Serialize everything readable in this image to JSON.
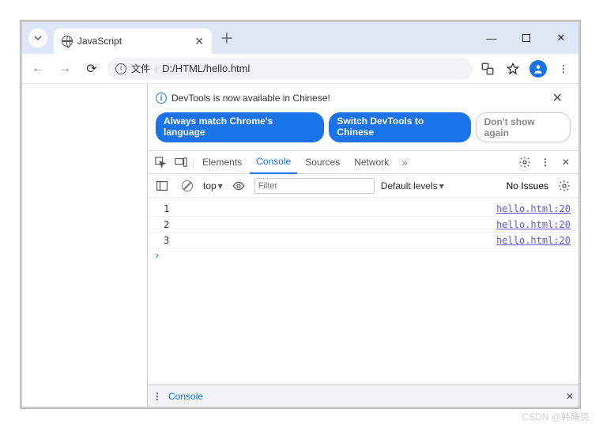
{
  "tab": {
    "title": "JavaScript"
  },
  "addressbar": {
    "prefix_label": "文件",
    "url": "D:/HTML/hello.html"
  },
  "infobar": {
    "text": "DevTools is now available in Chinese!",
    "chips": {
      "match": "Always match Chrome's language",
      "switch": "Switch DevTools to Chinese",
      "dont": "Don't show again"
    }
  },
  "devtools_tabs": {
    "elements": "Elements",
    "console": "Console",
    "sources": "Sources",
    "network": "Network"
  },
  "console_toolbar": {
    "context": "top",
    "filter_placeholder": "Filter",
    "levels": "Default levels",
    "issues": "No Issues"
  },
  "console_rows": [
    {
      "value": "1",
      "source": "hello.html:20"
    },
    {
      "value": "2",
      "source": "hello.html:20"
    },
    {
      "value": "3",
      "source": "hello.html:20"
    }
  ],
  "drawer": {
    "label": "Console"
  },
  "watermark": "CSDN @韩曙亮"
}
